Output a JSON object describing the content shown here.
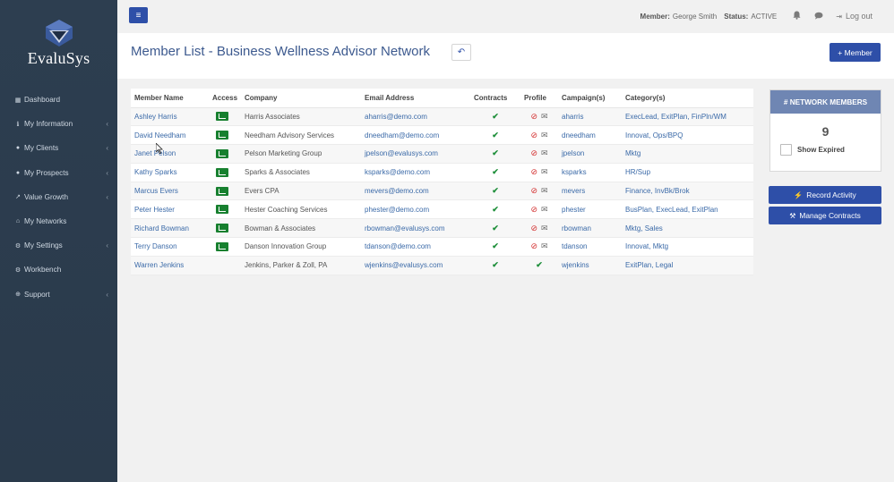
{
  "app": {
    "logo_text": "EvaluSys"
  },
  "sidebar": {
    "items": [
      {
        "label": "Dashboard",
        "icon": "dashboard-icon",
        "glyph": "▦",
        "chevron": ""
      },
      {
        "label": "My Information",
        "icon": "info-icon",
        "glyph": "ℹ",
        "chevron": "‹"
      },
      {
        "label": "My Clients",
        "icon": "user-icon",
        "glyph": "●",
        "chevron": "‹"
      },
      {
        "label": "My Prospects",
        "icon": "users-icon",
        "glyph": "●",
        "chevron": "‹"
      },
      {
        "label": "Value Growth",
        "icon": "line-chart-icon",
        "glyph": "↗",
        "chevron": "‹"
      },
      {
        "label": "My Networks",
        "icon": "sitemap-icon",
        "glyph": "⌂",
        "chevron": ""
      },
      {
        "label": "My Settings",
        "icon": "gear-icon",
        "glyph": "⚙",
        "chevron": "‹"
      },
      {
        "label": "Workbench",
        "icon": "cogs-icon",
        "glyph": "⚙",
        "chevron": ""
      },
      {
        "label": "Support",
        "icon": "globe-icon",
        "glyph": "⊕",
        "chevron": "‹"
      }
    ]
  },
  "topbar": {
    "menu_glyph": "≡",
    "member_label": "Member:",
    "member_value": "George Smith",
    "status_label": "Status:",
    "status_value": "ACTIVE",
    "bell_glyph": "🔔",
    "chat_glyph": "💬",
    "logout_glyph": "⇥",
    "logout_label": "Log out"
  },
  "header": {
    "title": "Member List - Business Wellness Advisor Network",
    "back_glyph": "↶",
    "add_member_label": "+ Member"
  },
  "table": {
    "columns": [
      "Member Name",
      "Access",
      "Company",
      "Email Address",
      "Contracts",
      "Profile",
      "Campaign(s)",
      "Category(s)"
    ],
    "rows": [
      {
        "name": "Ashley Harris",
        "access": true,
        "company": "Harris Associates",
        "email": "aharris@demo.com",
        "contracts": "✔",
        "profile_ok": false,
        "campaign": "aharris",
        "category": "ExecLead, ExitPlan, FinPln/WM"
      },
      {
        "name": "David Needham",
        "access": true,
        "company": "Needham Advisory Services",
        "email": "dneedham@demo.com",
        "contracts": "✔",
        "profile_ok": false,
        "campaign": "dneedham",
        "category": "Innovat, Ops/BPQ"
      },
      {
        "name": "Janet Pelson",
        "access": true,
        "company": "Pelson Marketing Group",
        "email": "jpelson@evalusys.com",
        "contracts": "✔",
        "profile_ok": false,
        "campaign": "jpelson",
        "category": "Mktg"
      },
      {
        "name": "Kathy Sparks",
        "access": true,
        "company": "Sparks & Associates",
        "email": "ksparks@demo.com",
        "contracts": "✔",
        "profile_ok": false,
        "campaign": "ksparks",
        "category": "HR/Sup"
      },
      {
        "name": "Marcus Evers",
        "access": true,
        "company": "Evers CPA",
        "email": "mevers@demo.com",
        "contracts": "✔",
        "profile_ok": false,
        "campaign": "mevers",
        "category": "Finance, InvBk/Brok"
      },
      {
        "name": "Peter Hester",
        "access": true,
        "company": "Hester Coaching Services",
        "email": "phester@demo.com",
        "contracts": "✔",
        "profile_ok": false,
        "campaign": "phester",
        "category": "BusPlan, ExecLead, ExitPlan"
      },
      {
        "name": "Richard Bowman",
        "access": true,
        "company": "Bowman & Associates",
        "email": "rbowman@evalusys.com",
        "contracts": "✔",
        "profile_ok": false,
        "campaign": "rbowman",
        "category": "Mktg, Sales"
      },
      {
        "name": "Terry Danson",
        "access": true,
        "company": "Danson Innovation Group",
        "email": "tdanson@demo.com",
        "contracts": "✔",
        "profile_ok": false,
        "campaign": "tdanson",
        "category": "Innovat, Mktg"
      },
      {
        "name": "Warren Jenkins",
        "access": false,
        "company": "Jenkins, Parker & Zoll, PA",
        "email": "wjenkins@evalusys.com",
        "contracts": "✔",
        "profile_ok": true,
        "campaign": "wjenkins",
        "category": "ExitPlan, Legal"
      }
    ]
  },
  "panel": {
    "title": "# NETWORK MEMBERS",
    "count": "9",
    "show_expired_label": "Show Expired"
  },
  "actions": {
    "record_activity_label": "Record Activity",
    "record_activity_glyph": "⚡",
    "manage_contracts_label": "Manage Contracts",
    "manage_contracts_glyph": "⚒"
  },
  "colors": {
    "sidebar_bg": "#2d3e50",
    "accent": "#2e4fa8",
    "panel_head": "#6f86b3",
    "access_green": "#17802f",
    "link": "#3b6aa8"
  }
}
